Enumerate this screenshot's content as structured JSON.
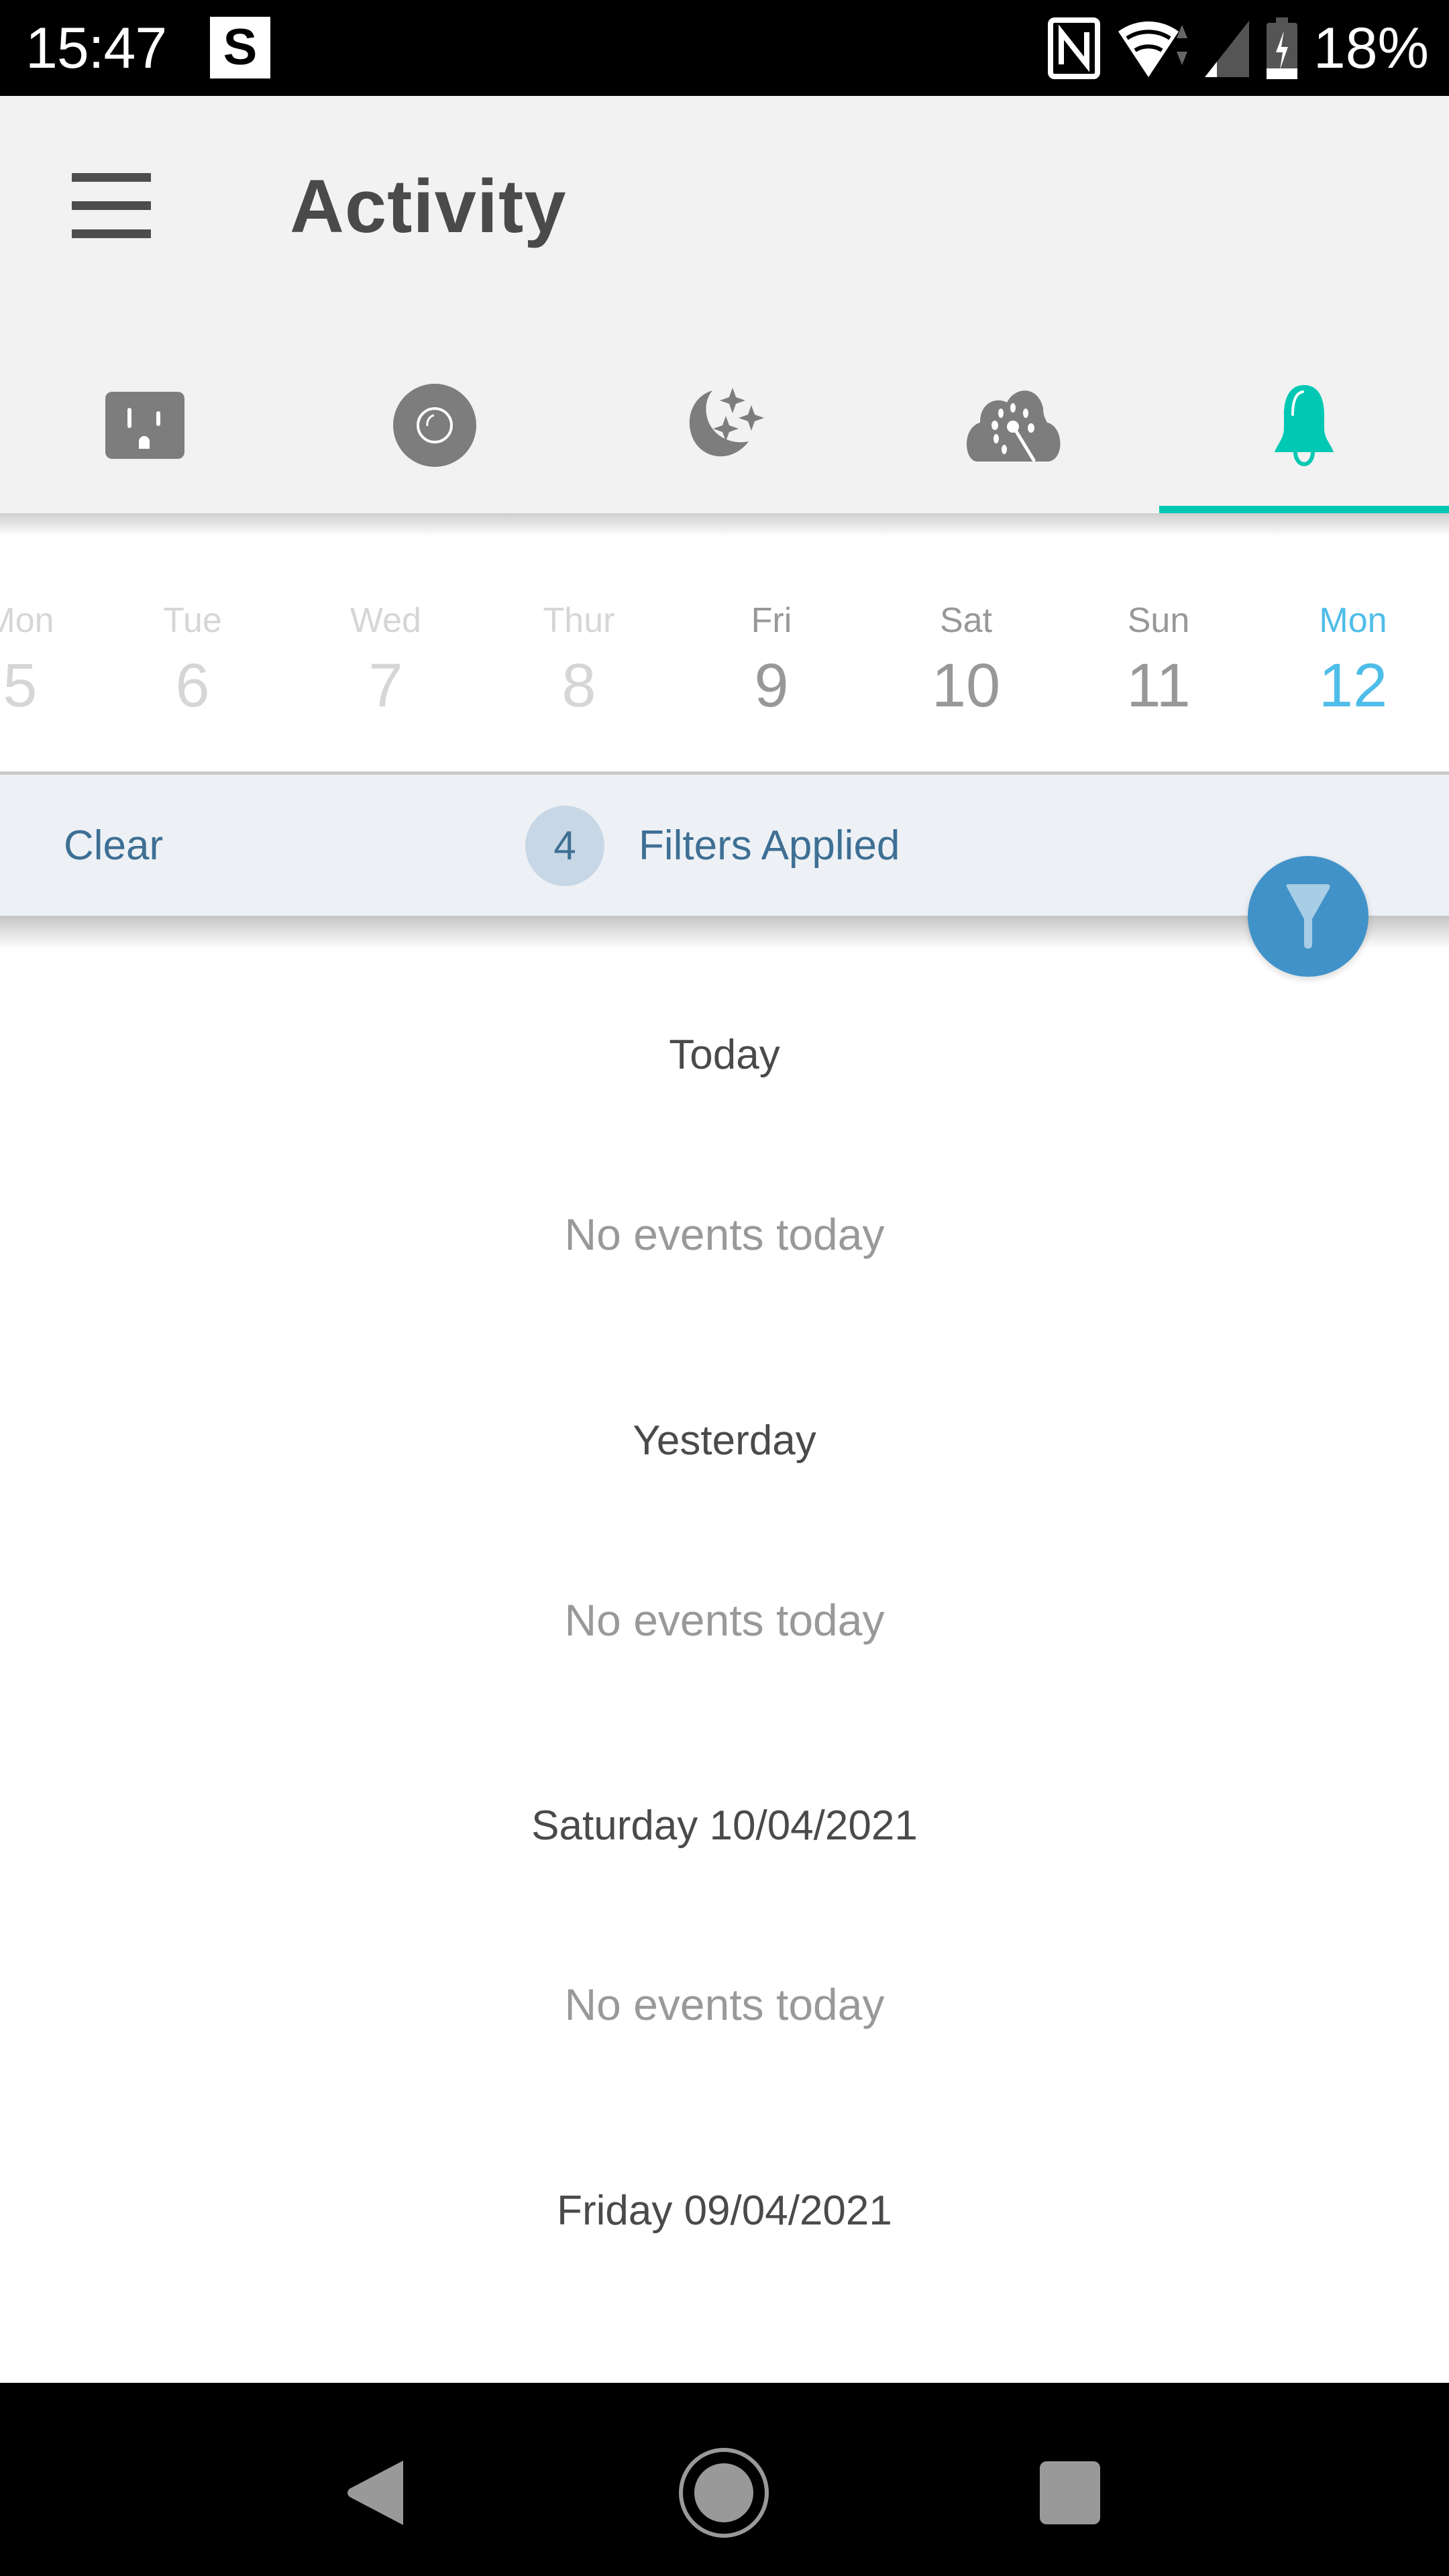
{
  "status_bar": {
    "time": "15:47",
    "notification_icon_letter": "S",
    "battery_percent": "18%",
    "icons": [
      "nfc-icon",
      "wifi-icon",
      "cell-signal-icon",
      "battery-charging-icon"
    ]
  },
  "app_bar": {
    "title": "Activity",
    "menu_icon": "hamburger-menu-icon"
  },
  "tabs": [
    {
      "name": "outlet",
      "icon": "power-outlet-icon",
      "active": false
    },
    {
      "name": "camera",
      "icon": "camera-lens-icon",
      "active": false
    },
    {
      "name": "night",
      "icon": "moon-stars-icon",
      "active": false
    },
    {
      "name": "cloud-magic",
      "icon": "cloud-magic-wand-icon",
      "active": false
    },
    {
      "name": "notifications",
      "icon": "bell-icon",
      "active": true
    }
  ],
  "date_strip": {
    "days": [
      {
        "weekday": "Mon",
        "day": "5",
        "state": "faded"
      },
      {
        "weekday": "Tue",
        "day": "6",
        "state": "faded"
      },
      {
        "weekday": "Wed",
        "day": "7",
        "state": "faded"
      },
      {
        "weekday": "Thur",
        "day": "8",
        "state": "faded"
      },
      {
        "weekday": "Fri",
        "day": "9",
        "state": "normal"
      },
      {
        "weekday": "Sat",
        "day": "10",
        "state": "normal"
      },
      {
        "weekday": "Sun",
        "day": "11",
        "state": "normal"
      },
      {
        "weekday": "Mon",
        "day": "12",
        "state": "active"
      }
    ]
  },
  "filter_bar": {
    "clear_label": "Clear",
    "count": "4",
    "applied_label": "Filters Applied",
    "fab_icon": "filter-funnel-icon"
  },
  "events": [
    {
      "title": "Today",
      "empty_text": "No events today"
    },
    {
      "title": "Yesterday",
      "empty_text": "No events today"
    },
    {
      "title": "Saturday 10/04/2021",
      "empty_text": "No events today"
    },
    {
      "title": "Friday 09/04/2021",
      "empty_text": ""
    }
  ],
  "nav_bar": {
    "back_icon": "back-triangle-icon",
    "home_icon": "home-circle-icon",
    "recents_icon": "recents-square-icon"
  },
  "colors": {
    "accent_teal": "#00c8b3",
    "active_date_blue": "#4fbde9",
    "filter_text": "#3e6f94",
    "fab_blue": "#4192c8",
    "icon_gray": "#7d7d7d"
  }
}
